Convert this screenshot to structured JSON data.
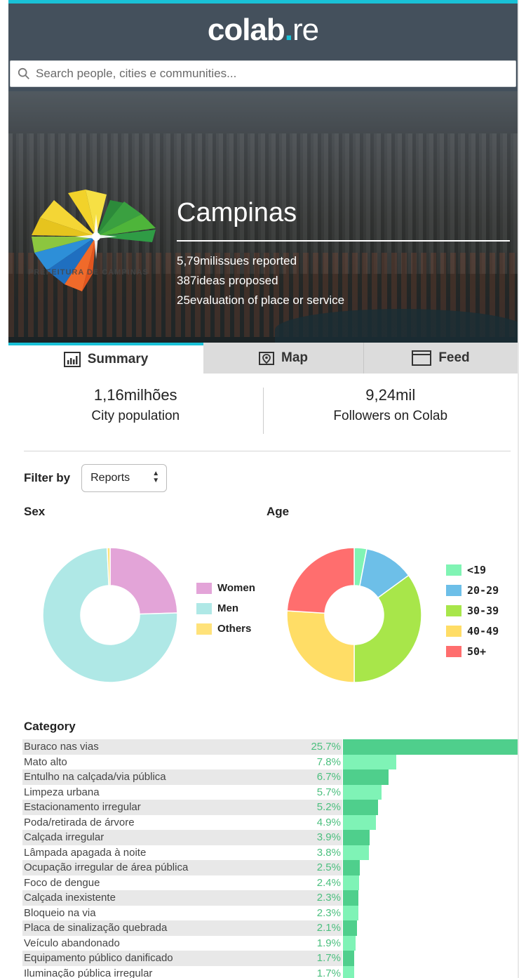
{
  "app": {
    "logo_main": "colab",
    "logo_dot": ".",
    "logo_suffix": "re"
  },
  "search": {
    "placeholder": "Search people, cities e communities..."
  },
  "city": {
    "name": "Campinas",
    "logo_text": "PREFEITURA DE CAMPINAS",
    "stats": [
      "5,79milissues reported",
      "387ideas proposed",
      "25evaluation of place or service"
    ]
  },
  "tabs": [
    {
      "label": "Summary",
      "icon": "bar-chart-icon",
      "active": true
    },
    {
      "label": "Map",
      "icon": "map-pin-icon",
      "active": false
    },
    {
      "label": "Feed",
      "icon": "window-icon",
      "active": false
    }
  ],
  "summary": {
    "population": {
      "value": "1,16milhões",
      "label": "City population"
    },
    "followers": {
      "value": "9,24mil",
      "label": "Followers on Colab"
    }
  },
  "filter": {
    "label": "Filter by",
    "selected": "Reports"
  },
  "colors": {
    "accent": "#19c1d7",
    "header": "#44505c",
    "bar_green": "#5ed89a",
    "bar_green_dark": "#4fcf8c"
  },
  "chart_data": [
    {
      "type": "pie",
      "title": "Sex",
      "categories": [
        "Women",
        "Men",
        "Others"
      ],
      "values": [
        24.5,
        74.8,
        0.7
      ],
      "colors": [
        "#e3a4d8",
        "#afe8e6",
        "#ffe27a"
      ],
      "legend": "right"
    },
    {
      "type": "pie",
      "title": "Age",
      "categories": [
        "<19",
        "20-29",
        "30-39",
        "40-49",
        "50+"
      ],
      "values": [
        3,
        12,
        35,
        26,
        24
      ],
      "colors": [
        "#80f4b4",
        "#6dbfe8",
        "#a8e64a",
        "#ffdd66",
        "#ff6e6e"
      ],
      "legend": "right"
    },
    {
      "type": "bar",
      "title": "Category",
      "orientation": "horizontal",
      "categories": [
        "Buraco nas vias",
        "Mato alto",
        "Entulho na calçada/via pública",
        "Limpeza urbana",
        "Estacionamento irregular",
        "Poda/retirada de árvore",
        "Calçada irregular",
        "Lâmpada apagada à noite",
        "Ocupação irregular de área pública",
        "Foco de dengue",
        "Calçada inexistente",
        "Bloqueio na via",
        "Placa de sinalização quebrada",
        "Veículo abandonado",
        "Equipamento público danificado",
        "Iluminação pública irregular"
      ],
      "values": [
        25.7,
        7.8,
        6.7,
        5.7,
        5.2,
        4.9,
        3.9,
        3.8,
        2.5,
        2.4,
        2.3,
        2.3,
        2.1,
        1.9,
        1.7,
        1.7
      ],
      "labels": [
        "25.7%",
        "7.8%",
        "6.7%",
        "5.7%",
        "5.2%",
        "4.9%",
        "3.9%",
        "3.8%",
        "2.5%",
        "2.4%",
        "2.3%",
        "2.3%",
        "2.1%",
        "1.9%",
        "1.7%",
        "1.7%"
      ]
    }
  ]
}
